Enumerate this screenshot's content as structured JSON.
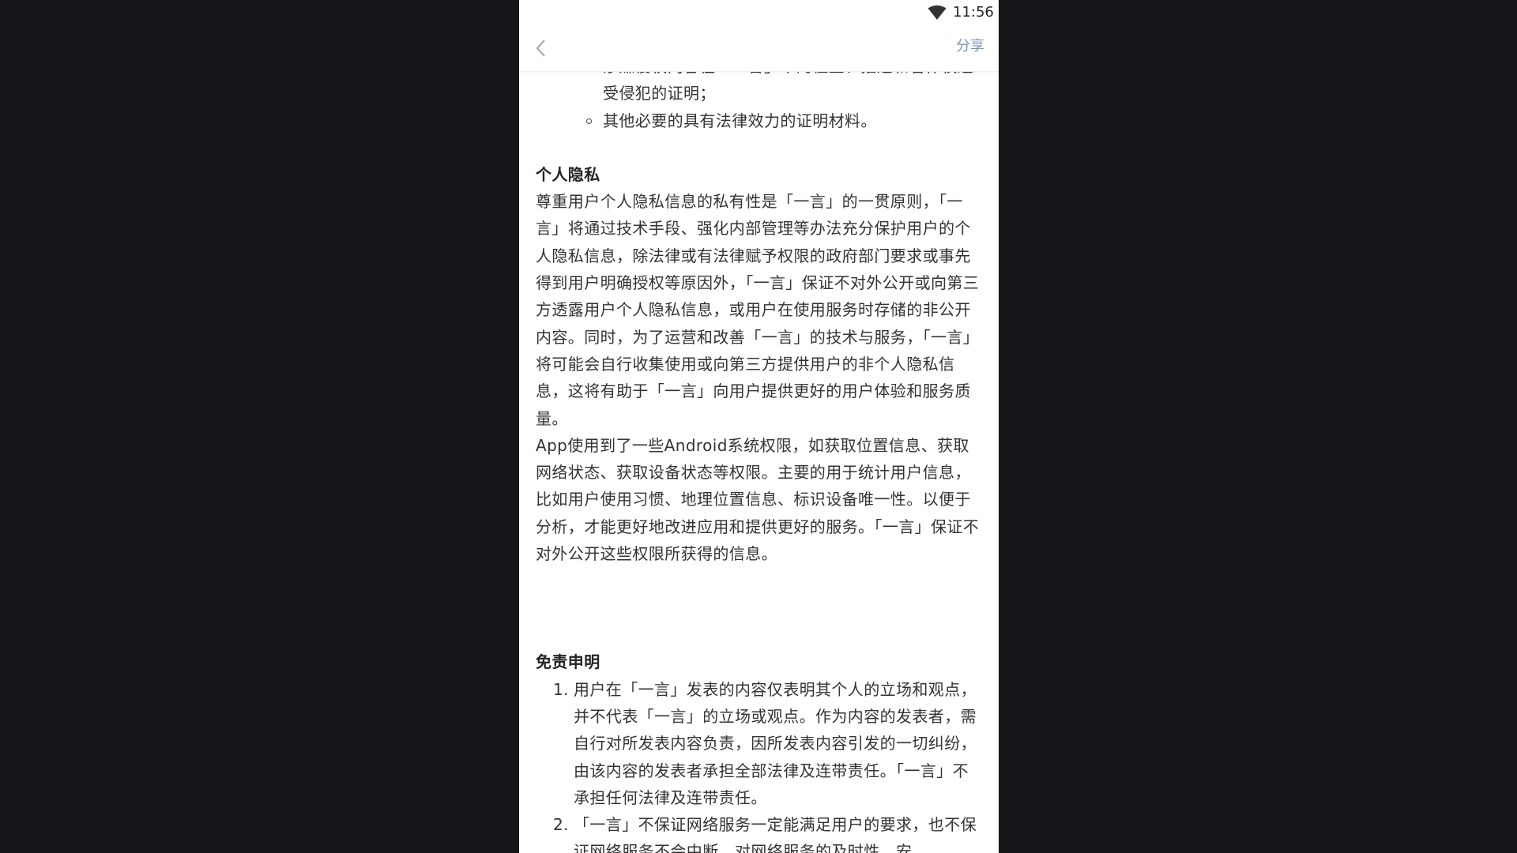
{
  "status_bar": {
    "time": "11:56",
    "icons": [
      "wifi-icon"
    ]
  },
  "app_bar": {
    "back_icon": "chevron-left-icon",
    "share_label": "分享"
  },
  "colors": {
    "accent": "#7d95b5",
    "text": "#333333",
    "background": "#ffffff",
    "outer_background": "#15151a"
  },
  "content": {
    "bullets": [
      "涉嫌侵权内容在「一言」中的位置、描述和著作权遭受侵犯的证明；",
      "其他必要的具有法律效力的证明材料。"
    ],
    "privacy_heading": "个人隐私",
    "privacy_paragraph_1": "尊重用户个人隐私信息的私有性是「一言」的一贯原则，「一言」将通过技术手段、强化内部管理等办法充分保护用户的个人隐私信息，除法律或有法律赋予权限的政府部门要求或事先得到用户明确授权等原因外，「一言」保证不对外公开或向第三方透露用户个人隐私信息，或用户在使用服务时存储的非公开内容。同时，为了运营和改善「一言」的技术与服务，「一言」将可能会自行收集使用或向第三方提供用户的非个人隐私信息，这将有助于「一言」向用户提供更好的用户体验和服务质量。",
    "privacy_paragraph_2": "App使用到了一些Android系统权限，如获取位置信息、获取网络状态、获取设备状态等权限。主要的用于统计用户信息，比如用户使用习惯、地理位置信息、标识设备唯一性。以便于分析，才能更好地改进应用和提供更好的服务。「一言」保证不对外公开这些权限所获得的信息。",
    "disclaimer_heading": "免责申明",
    "disclaimer_items": [
      {
        "num": "1.",
        "text": "用户在「一言」发表的内容仅表明其个人的立场和观点，并不代表「一言」的立场或观点。作为内容的发表者，需自行对所发表内容负责，因所发表内容引发的一切纠纷，由该内容的发表者承担全部法律及连带责任。「一言」不承担任何法律及连带责任。"
      },
      {
        "num": "2.",
        "text": "「一言」不保证网络服务一定能满足用户的要求，也不保证网络服务不会中断，对网络服务的及时性、安"
      }
    ]
  }
}
